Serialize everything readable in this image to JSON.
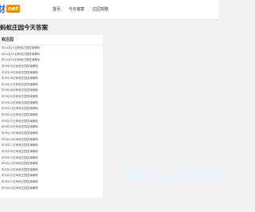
{
  "header": {
    "logo_text": "财",
    "logo_badge": "net",
    "nav": [
      "首页",
      "今日答案",
      "庄园攻略"
    ]
  },
  "page": {
    "title": "蚂蚁庄园今天答案"
  },
  "panel": {
    "header": "蚁庄园",
    "items": [
      "年10月21日蚂蚁庄园答案解析",
      "年10月20日蚂蚁庄园答案解析",
      "年10月19日蚂蚁庄园答案解析",
      "年9月30日蚂蚁庄园答案解析",
      "年9月29日蚂蚁庄园答案解析",
      "年9月28日蚂蚁庄园答案解析",
      "年9月27日蚂蚁庄园答案解析",
      "年9月26日蚂蚁庄园答案解析",
      "年9月25日蚂蚁庄园答案解析",
      "年9月24日蚂蚁庄园答案解析",
      "年9月23日蚂蚁庄园答案解析",
      "年9月22日蚂蚁庄园答案解析",
      "年9月21日蚂蚁庄园答案解析",
      "年9月20日蚂蚁庄园答案解析",
      "年9月19日蚂蚁庄园答案解析",
      "年9月18日蚂蚁庄园答案解析",
      "年9月17日蚂蚁庄园答案解析",
      "年9月16日蚂蚁庄园答案解析",
      "年9月15日蚂蚁庄园答案解析",
      "年9月14日蚂蚁庄园答案解析",
      "年9月13日蚂蚁庄园答案解析",
      "年9月12日蚂蚁庄园答案解析",
      "年9月11日蚂蚁庄园答案解析",
      "年9月10日蚂蚁庄园答案解析"
    ]
  },
  "watermark": "0401导航库",
  "colors": {
    "logo_blue": "#2a6fd6",
    "logo_orange": "#ff8a00",
    "background": "#f2f2f2",
    "watermark": "#eaf2fb"
  }
}
